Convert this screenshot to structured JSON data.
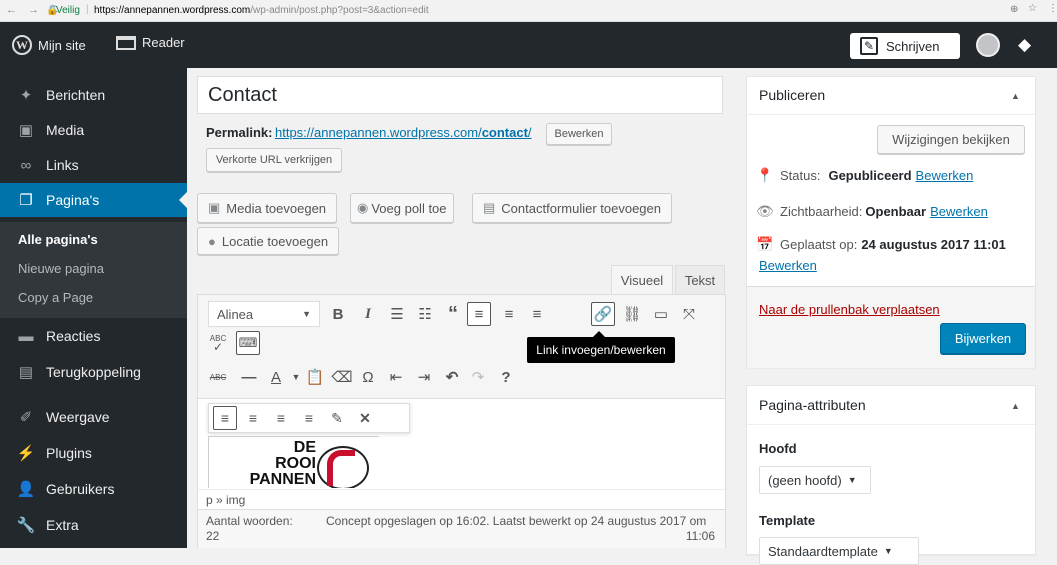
{
  "browser": {
    "secure_label": "Veilig",
    "url_host": "https://annepannen.wordpress.com",
    "url_path": "/wp-admin/post.php?post=3&action=edit"
  },
  "adminbar": {
    "site_label": "Mijn site",
    "reader_label": "Reader",
    "write_label": "Schrijven"
  },
  "sidebar": {
    "items": [
      {
        "label": "Berichten",
        "icon": "pin-icon"
      },
      {
        "label": "Media",
        "icon": "media-icon"
      },
      {
        "label": "Links",
        "icon": "link-icon"
      },
      {
        "label": "Pagina's",
        "icon": "pages-icon"
      },
      {
        "label": "Reacties",
        "icon": "comments-icon"
      },
      {
        "label": "Terugkoppeling",
        "icon": "feedback-icon"
      },
      {
        "label": "Weergave",
        "icon": "brush-icon"
      },
      {
        "label": "Plugins",
        "icon": "plug-icon"
      },
      {
        "label": "Gebruikers",
        "icon": "users-icon"
      },
      {
        "label": "Extra",
        "icon": "wrench-icon"
      }
    ],
    "submenu": [
      "Alle pagina's",
      "Nieuwe pagina",
      "Copy a Page"
    ]
  },
  "editor": {
    "title": "Contact",
    "permalink_label": "Permalink:",
    "permalink_base": "https://annepannen.wordpress.com/",
    "permalink_slug": "contact",
    "permalink_end": "/",
    "edit_permalink": "Bewerken",
    "shortlink": "Verkorte URL verkrijgen",
    "media_buttons": [
      "Media toevoegen",
      "Voeg poll toe",
      "Contactformulier toevoegen",
      "Locatie toevoegen"
    ],
    "tabs": [
      "Visueel",
      "Tekst"
    ],
    "format_select": "Alinea",
    "tooltip": "Link invoegen/bewerken",
    "spellcheck_label": "ABC",
    "strike_label": "ABC",
    "logo_lines": [
      "DE",
      "ROOI",
      "PANNEN"
    ],
    "path": "p » img",
    "word_count": "Aantal woorden:",
    "word_count_value": "22",
    "draft_status": "Concept opgeslagen op 16:02. Laatst bewerkt op 24 augustus 2017 om",
    "draft_time": "11:06"
  },
  "publish": {
    "title": "Publiceren",
    "preview": "Wijzigingen bekijken",
    "status_label": "Status:",
    "status_value": "Gepubliceerd",
    "visibility_label": "Zichtbaarheid:",
    "visibility_value": "Openbaar",
    "date_label": "Geplaatst op:",
    "date_value": "24 augustus 2017 11:01",
    "edit_link": "Bewerken",
    "trash": "Naar de prullenbak verplaatsen",
    "update": "Bijwerken"
  },
  "attributes": {
    "title": "Pagina-attributen",
    "parent_label": "Hoofd",
    "parent_value": "(geen hoofd)",
    "template_label": "Template",
    "template_value": "Standaardtemplate"
  },
  "colors": {
    "accent": "#0073aa",
    "sidebar": "#23282d",
    "primary_button": "#0085ba",
    "trash": "#a00000"
  }
}
